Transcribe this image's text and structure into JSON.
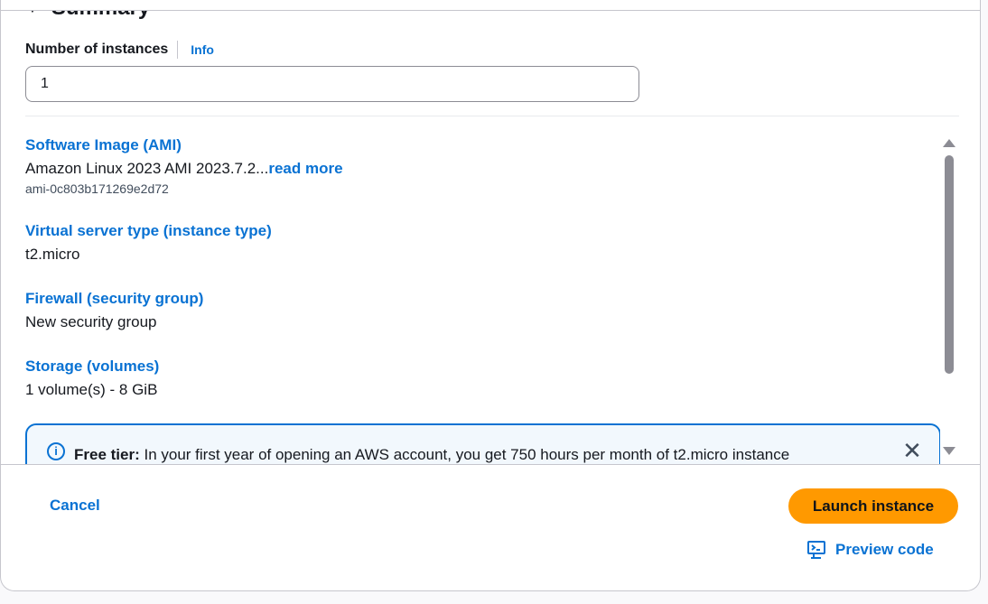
{
  "summary": {
    "heading": "Summary",
    "instances_label": "Number of instances",
    "info_label": "Info",
    "instances_value": "1"
  },
  "sections": {
    "ami": {
      "title": "Software Image (AMI)",
      "value": "Amazon Linux 2023 AMI 2023.7.2...",
      "read_more": "read more",
      "id": "ami-0c803b171269e2d72"
    },
    "instance_type": {
      "title": "Virtual server type (instance type)",
      "value": "t2.micro"
    },
    "firewall": {
      "title": "Firewall (security group)",
      "value": "New security group"
    },
    "storage": {
      "title": "Storage (volumes)",
      "value": "1 volume(s) - 8 GiB"
    }
  },
  "alert": {
    "bold": "Free tier:",
    "text": " In your first year of opening an AWS account, you get 750 hours per month of t2.micro instance"
  },
  "footer": {
    "cancel_label": "Cancel",
    "launch_label": "Launch instance",
    "preview_label": "Preview code"
  },
  "colors": {
    "link": "#0972d3",
    "primary_button": "#ff9900",
    "alert_border": "#0972d3",
    "alert_bg": "#f2f8fd"
  },
  "icons": {
    "caret": "caret-down-icon",
    "info": "info-circle-icon",
    "close": "close-icon",
    "preview": "preview-code-icon"
  }
}
